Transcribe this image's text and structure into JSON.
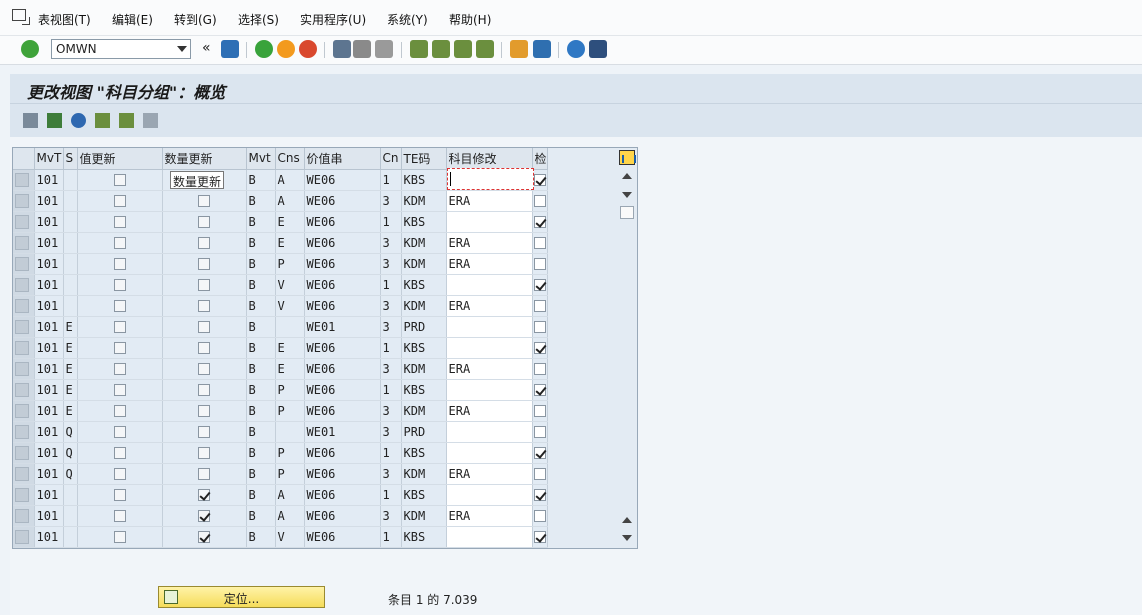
{
  "menu": [
    "表视图(T)",
    "编辑(E)",
    "转到(G)",
    "选择(S)",
    "实用程序(U)",
    "系统(Y)",
    "帮助(H)"
  ],
  "command_field": "OMWN",
  "title": "更改视图 \"科目分组\"：概览",
  "columns": [
    "MvT",
    "S",
    "值更新",
    "数量更新",
    "Mvt",
    "Cns",
    "价值串",
    "Cn",
    "TE码",
    "科目修改",
    "检"
  ],
  "rows": [
    {
      "mvt": "101",
      "s": "",
      "val": false,
      "qty": false,
      "mv": "B",
      "cns": "A",
      "vs": "WE06",
      "cn": "1",
      "te": "KBS",
      "acct": "",
      "chk": true
    },
    {
      "mvt": "101",
      "s": "",
      "val": false,
      "qty": false,
      "mv": "B",
      "cns": "A",
      "vs": "WE06",
      "cn": "3",
      "te": "KDM",
      "acct": "ERA",
      "chk": false
    },
    {
      "mvt": "101",
      "s": "",
      "val": false,
      "qty": false,
      "mv": "B",
      "cns": "E",
      "vs": "WE06",
      "cn": "1",
      "te": "KBS",
      "acct": "",
      "chk": true
    },
    {
      "mvt": "101",
      "s": "",
      "val": false,
      "qty": false,
      "mv": "B",
      "cns": "E",
      "vs": "WE06",
      "cn": "3",
      "te": "KDM",
      "acct": "ERA",
      "chk": false
    },
    {
      "mvt": "101",
      "s": "",
      "val": false,
      "qty": false,
      "mv": "B",
      "cns": "P",
      "vs": "WE06",
      "cn": "3",
      "te": "KDM",
      "acct": "ERA",
      "chk": false
    },
    {
      "mvt": "101",
      "s": "",
      "val": false,
      "qty": false,
      "mv": "B",
      "cns": "V",
      "vs": "WE06",
      "cn": "1",
      "te": "KBS",
      "acct": "",
      "chk": true
    },
    {
      "mvt": "101",
      "s": "",
      "val": false,
      "qty": false,
      "mv": "B",
      "cns": "V",
      "vs": "WE06",
      "cn": "3",
      "te": "KDM",
      "acct": "ERA",
      "chk": false
    },
    {
      "mvt": "101",
      "s": "E",
      "val": false,
      "qty": false,
      "mv": "B",
      "cns": "",
      "vs": "WE01",
      "cn": "3",
      "te": "PRD",
      "acct": "",
      "chk": false
    },
    {
      "mvt": "101",
      "s": "E",
      "val": false,
      "qty": false,
      "mv": "B",
      "cns": "E",
      "vs": "WE06",
      "cn": "1",
      "te": "KBS",
      "acct": "",
      "chk": true
    },
    {
      "mvt": "101",
      "s": "E",
      "val": false,
      "qty": false,
      "mv": "B",
      "cns": "E",
      "vs": "WE06",
      "cn": "3",
      "te": "KDM",
      "acct": "ERA",
      "chk": false
    },
    {
      "mvt": "101",
      "s": "E",
      "val": false,
      "qty": false,
      "mv": "B",
      "cns": "P",
      "vs": "WE06",
      "cn": "1",
      "te": "KBS",
      "acct": "",
      "chk": true
    },
    {
      "mvt": "101",
      "s": "E",
      "val": false,
      "qty": false,
      "mv": "B",
      "cns": "P",
      "vs": "WE06",
      "cn": "3",
      "te": "KDM",
      "acct": "ERA",
      "chk": false
    },
    {
      "mvt": "101",
      "s": "Q",
      "val": false,
      "qty": false,
      "mv": "B",
      "cns": "",
      "vs": "WE01",
      "cn": "3",
      "te": "PRD",
      "acct": "",
      "chk": false
    },
    {
      "mvt": "101",
      "s": "Q",
      "val": false,
      "qty": false,
      "mv": "B",
      "cns": "P",
      "vs": "WE06",
      "cn": "1",
      "te": "KBS",
      "acct": "",
      "chk": true
    },
    {
      "mvt": "101",
      "s": "Q",
      "val": false,
      "qty": false,
      "mv": "B",
      "cns": "P",
      "vs": "WE06",
      "cn": "3",
      "te": "KDM",
      "acct": "ERA",
      "chk": false
    },
    {
      "mvt": "101",
      "s": "",
      "val": false,
      "qty": true,
      "mv": "B",
      "cns": "A",
      "vs": "WE06",
      "cn": "1",
      "te": "KBS",
      "acct": "",
      "chk": true
    },
    {
      "mvt": "101",
      "s": "",
      "val": false,
      "qty": true,
      "mv": "B",
      "cns": "A",
      "vs": "WE06",
      "cn": "3",
      "te": "KDM",
      "acct": "ERA",
      "chk": false
    },
    {
      "mvt": "101",
      "s": "",
      "val": false,
      "qty": true,
      "mv": "B",
      "cns": "V",
      "vs": "WE06",
      "cn": "1",
      "te": "KBS",
      "acct": "",
      "chk": true
    }
  ],
  "tooltip": "数量更新",
  "position_button": "定位...",
  "entry_status": "条目 1 的 7.039"
}
